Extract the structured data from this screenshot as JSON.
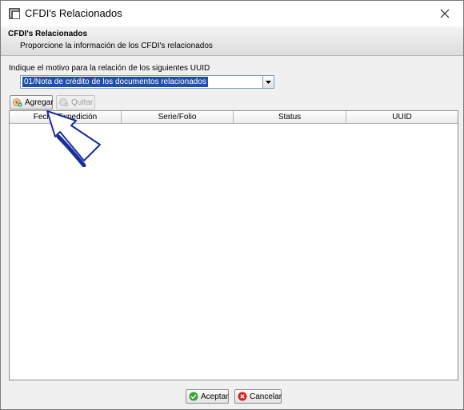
{
  "window": {
    "title": "CFDI's Relacionados",
    "close_icon": "close-icon"
  },
  "header": {
    "title": "CFDI's Relacionados",
    "subtitle": "Proporcione la información de los CFDI's relacionados"
  },
  "motivo": {
    "label": "Indique el motivo para la relación de los siguientes UUID",
    "selected": "01/Nota de crédito de los documentos relacionados"
  },
  "toolbar": {
    "add_label": "Agregar",
    "remove_label": "Quitar"
  },
  "table": {
    "columns": [
      "Fecha Expedición",
      "Serie/Folio",
      "Status",
      "UUID"
    ],
    "rows": []
  },
  "footer": {
    "accept_label": "Aceptar",
    "cancel_label": "Cancelar"
  },
  "colors": {
    "selection": "#1f4fa8",
    "cursor_arrow": "#1a2e9c",
    "accept_icon": "#3aa13a",
    "cancel_icon": "#d62020"
  }
}
